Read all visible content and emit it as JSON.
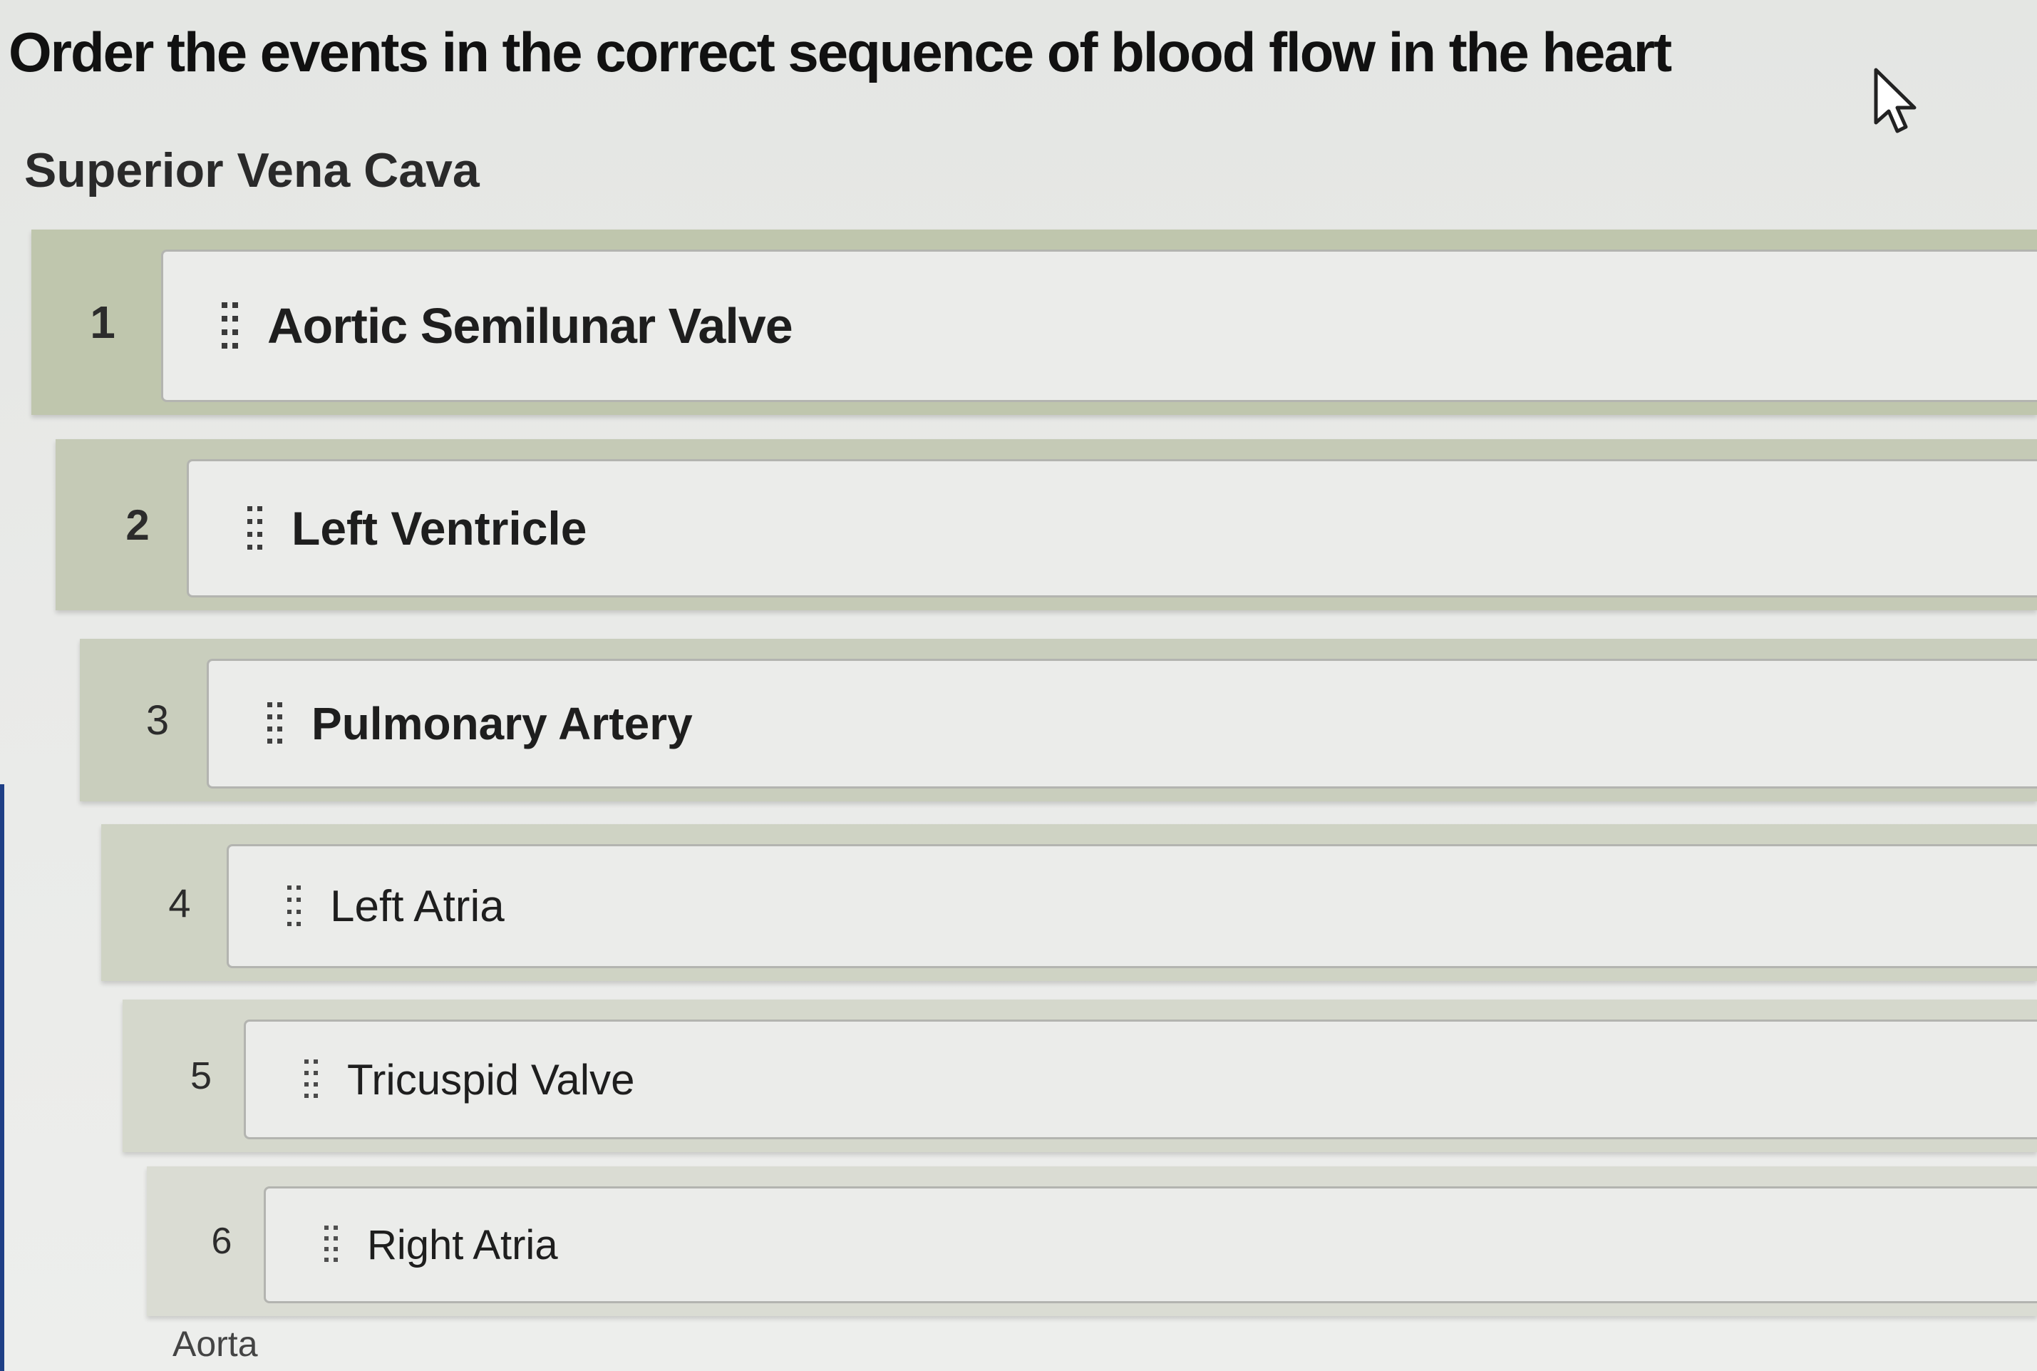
{
  "question": "Order the events in the correct sequence of blood flow in the heart",
  "start_label": "Superior Vena Cava",
  "end_label": "Aorta",
  "items": [
    {
      "number": "1",
      "label": "Aortic Semilunar Valve"
    },
    {
      "number": "2",
      "label": "Left Ventricle"
    },
    {
      "number": "3",
      "label": "Pulmonary Artery"
    },
    {
      "number": "4",
      "label": "Left Atria"
    },
    {
      "number": "5",
      "label": "Tricuspid Valve"
    },
    {
      "number": "6",
      "label": "Right Atria"
    }
  ],
  "icons": {
    "drag_handle": "drag-handle-icon",
    "cursor": "mouse-pointer-icon"
  },
  "colors": {
    "row_background": "#c4cab4",
    "card_background": "#ebecea",
    "left_rule": "#1f3f86"
  }
}
